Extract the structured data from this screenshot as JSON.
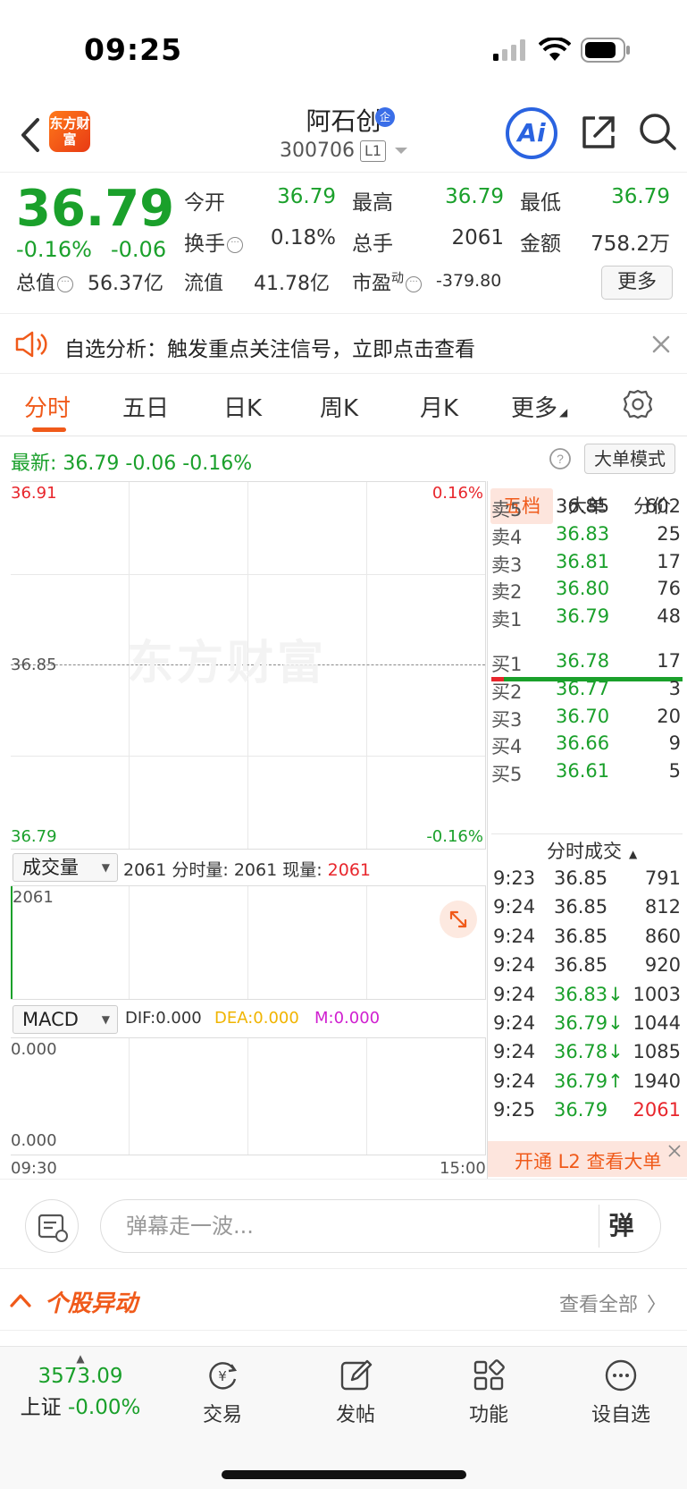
{
  "status": {
    "time": "09:25"
  },
  "header": {
    "app_logo_text": "东方财富",
    "stock_name": "阿石创",
    "enterprise_badge": "企",
    "stock_code": "300706",
    "level": "L1",
    "ai_label": "Ai"
  },
  "quote": {
    "last_price": "36.79",
    "change_pct": "-0.16%",
    "change_abs": "-0.06",
    "fields": {
      "open_label": "今开",
      "open": "36.79",
      "high_label": "最高",
      "high": "36.79",
      "low_label": "最低",
      "low": "36.79",
      "turnover_label": "换手",
      "turnover": "0.18%",
      "volume_label": "总手",
      "volume": "2061",
      "amount_label": "金额",
      "amount": "758.2万",
      "mktcap_label": "总值",
      "mktcap": "56.37亿",
      "float_label": "流值",
      "float_cap": "41.78亿",
      "pe_label": "市盈",
      "pe_sup": "动",
      "pe": "-379.80"
    },
    "more_label": "更多"
  },
  "alert": {
    "text": "自选分析：触发重点关注信号，立即点击查看"
  },
  "tabs": [
    {
      "label": "分时"
    },
    {
      "label": "五日"
    },
    {
      "label": "日K"
    },
    {
      "label": "周K"
    },
    {
      "label": "月K"
    },
    {
      "label": "更多"
    }
  ],
  "latest_line": "最新:  36.79  -0.06  -0.16%",
  "mode_button": "大单模式",
  "price_chart": {
    "top_price": "36.91",
    "top_pct": "0.16%",
    "mid_price": "36.85",
    "bottom_price": "36.79",
    "bottom_pct": "-0.16%",
    "watermark": "东方财富"
  },
  "volume_chart": {
    "selector": "成交量",
    "info_prefix": "2061 分时量: 2061 现量: ",
    "info_current": "2061",
    "axis_top": "2061"
  },
  "macd_chart": {
    "selector": "MACD",
    "dif": "DIF:0.000",
    "dea": "DEA:0.000",
    "m": "M:0.000",
    "axis_top": "0.000",
    "axis_bottom": "0.000",
    "time_start": "09:30",
    "time_end": "15:00"
  },
  "right_panel": {
    "tabs": [
      "五档",
      "大单",
      "分价"
    ],
    "sells": [
      {
        "label": "卖5",
        "price": "36.85",
        "vol": "602",
        "color": "#333333"
      },
      {
        "label": "卖4",
        "price": "36.83",
        "vol": "25",
        "color": "#1aa02b"
      },
      {
        "label": "卖3",
        "price": "36.81",
        "vol": "17",
        "color": "#1aa02b"
      },
      {
        "label": "卖2",
        "price": "36.80",
        "vol": "76",
        "color": "#1aa02b"
      },
      {
        "label": "卖1",
        "price": "36.79",
        "vol": "48",
        "color": "#1aa02b"
      }
    ],
    "buys": [
      {
        "label": "买1",
        "price": "36.78",
        "vol": "17",
        "color": "#1aa02b"
      },
      {
        "label": "买2",
        "price": "36.77",
        "vol": "3",
        "color": "#1aa02b"
      },
      {
        "label": "买3",
        "price": "36.70",
        "vol": "20",
        "color": "#1aa02b"
      },
      {
        "label": "买4",
        "price": "36.66",
        "vol": "9",
        "color": "#1aa02b"
      },
      {
        "label": "买5",
        "price": "36.61",
        "vol": "5",
        "color": "#1aa02b"
      }
    ],
    "ticks_title": "分时成交",
    "ticks": [
      {
        "time": "9:23",
        "price": "36.85",
        "vol": "791",
        "pcolor": "#333333",
        "vcolor": "#333333"
      },
      {
        "time": "9:24",
        "price": "36.85",
        "vol": "812",
        "pcolor": "#333333",
        "vcolor": "#333333"
      },
      {
        "time": "9:24",
        "price": "36.85",
        "vol": "860",
        "pcolor": "#333333",
        "vcolor": "#333333"
      },
      {
        "time": "9:24",
        "price": "36.85",
        "vol": "920",
        "pcolor": "#333333",
        "vcolor": "#333333"
      },
      {
        "time": "9:24",
        "price": "36.83↓",
        "vol": "1003",
        "pcolor": "#1aa02b",
        "vcolor": "#333333"
      },
      {
        "time": "9:24",
        "price": "36.79↓",
        "vol": "1044",
        "pcolor": "#1aa02b",
        "vcolor": "#333333"
      },
      {
        "time": "9:24",
        "price": "36.78↓",
        "vol": "1085",
        "pcolor": "#1aa02b",
        "vcolor": "#333333"
      },
      {
        "time": "9:24",
        "price": "36.79↑",
        "vol": "1940",
        "pcolor": "#1aa02b",
        "vcolor": "#333333"
      },
      {
        "time": "9:25",
        "price": "36.79",
        "vol": "2061",
        "pcolor": "#1aa02b",
        "vcolor": "#e8262c"
      }
    ],
    "l2_banner": "开通 L2 查看大单"
  },
  "chat": {
    "placeholder": "弹幕走一波...",
    "danmu_label": "弹"
  },
  "movement": {
    "title": "个股异动",
    "view_all": "查看全部"
  },
  "bottom_nav": {
    "index_value": "3573.09",
    "index_name": "上证",
    "index_change": "-0.00%",
    "items": [
      {
        "label": "交易",
        "icon": "trade-icon"
      },
      {
        "label": "发帖",
        "icon": "post-icon"
      },
      {
        "label": "功能",
        "icon": "function-icon"
      },
      {
        "label": "设自选",
        "icon": "watchlist-icon"
      }
    ]
  },
  "colors": {
    "up": "#e8262c",
    "down": "#1aa02b",
    "accent": "#f05a1a",
    "ai_blue": "#2a63e0"
  }
}
